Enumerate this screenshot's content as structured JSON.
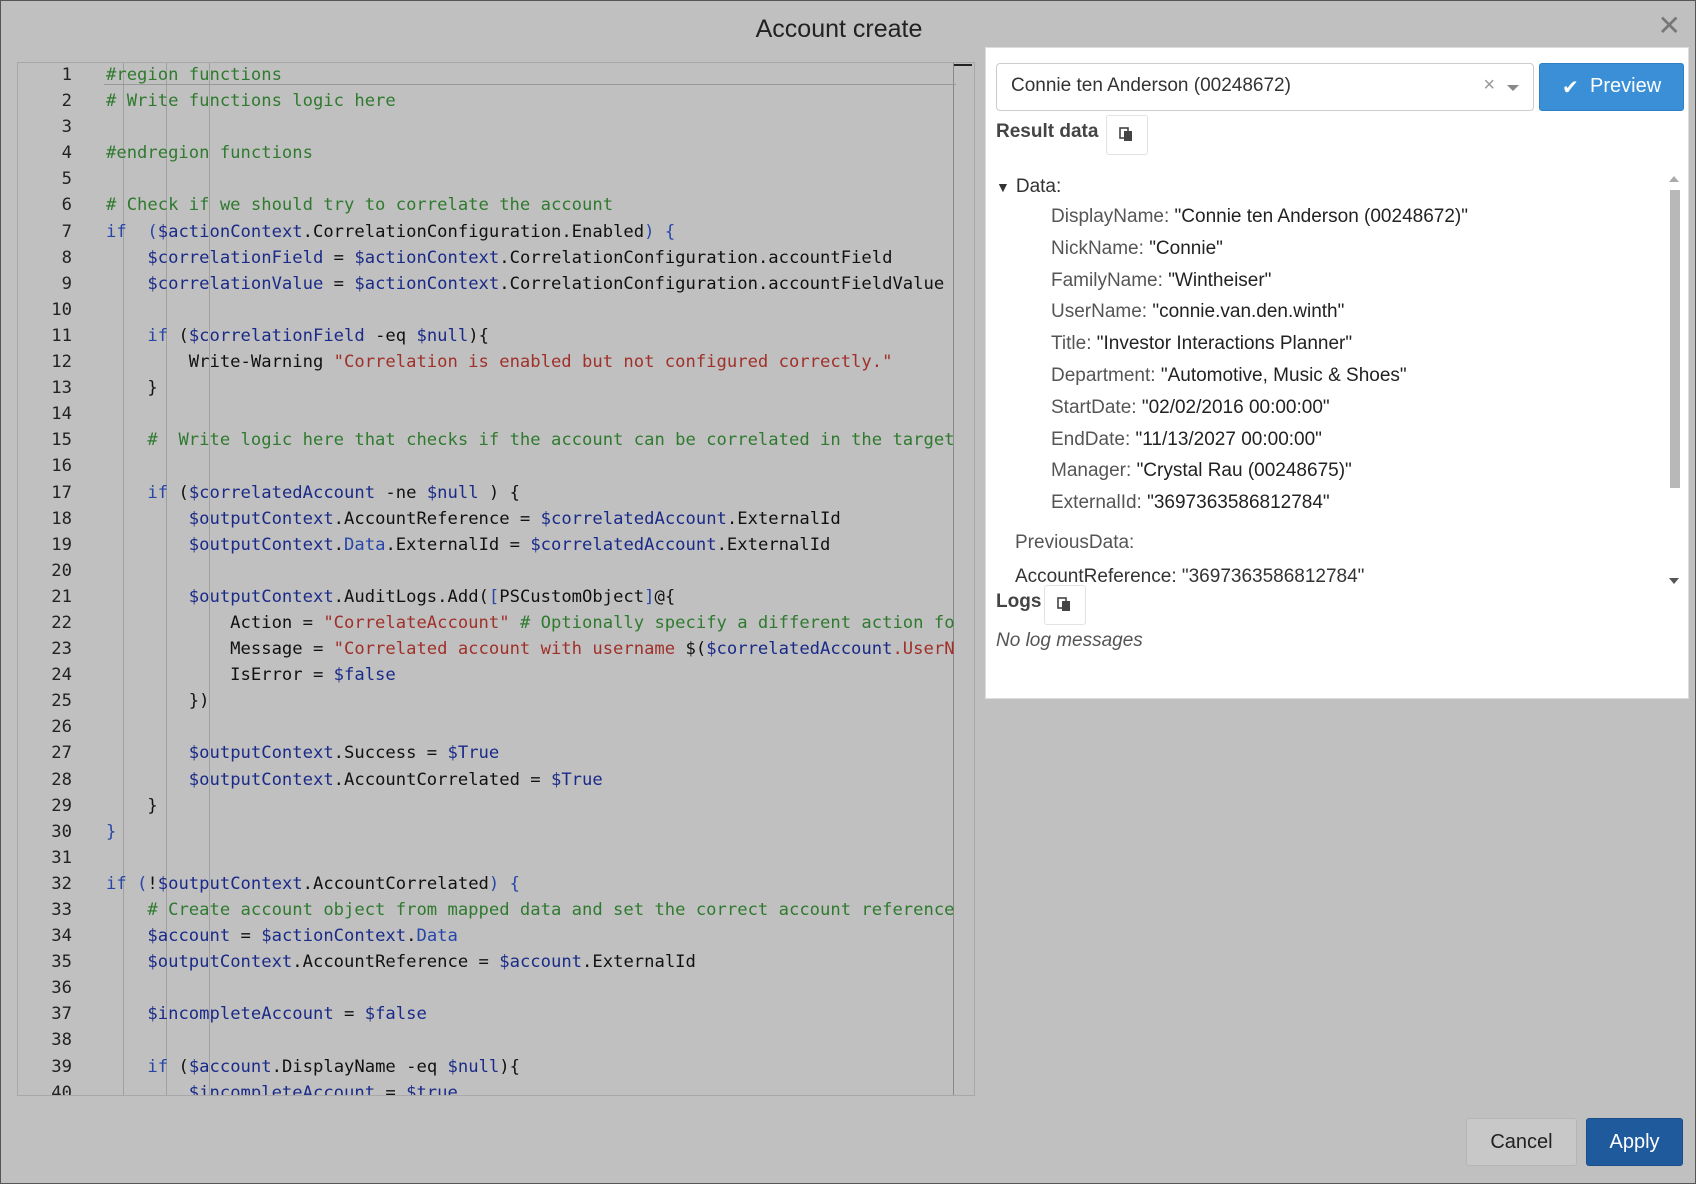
{
  "dialog": {
    "title": "Account create",
    "close": "✕"
  },
  "editor": {
    "lines": [
      {
        "n": "1",
        "t": [
          [
            "c",
            "#region functions"
          ]
        ]
      },
      {
        "n": "2",
        "t": [
          [
            "c",
            "# Write functions logic here"
          ]
        ]
      },
      {
        "n": "3",
        "t": []
      },
      {
        "n": "4",
        "t": [
          [
            "c",
            "#endregion functions"
          ]
        ]
      },
      {
        "n": "5",
        "t": []
      },
      {
        "n": "6",
        "t": [
          [
            "c",
            "# Check if we should try to correlate the account"
          ]
        ]
      },
      {
        "n": "7",
        "t": [
          [
            "k",
            "if"
          ],
          [
            "",
            "  "
          ],
          [
            "b",
            "("
          ],
          [
            "v",
            "$actionContext"
          ],
          [
            "",
            ".CorrelationConfiguration.Enabled"
          ],
          [
            "b",
            ")"
          ],
          [
            "",
            " "
          ],
          [
            "b",
            "{"
          ]
        ]
      },
      {
        "n": "8",
        "t": [
          [
            "",
            "    "
          ],
          [
            "v",
            "$correlationField"
          ],
          [
            "",
            " = "
          ],
          [
            "v",
            "$actionContext"
          ],
          [
            "",
            ".CorrelationConfiguration.accountField"
          ]
        ]
      },
      {
        "n": "9",
        "t": [
          [
            "",
            "    "
          ],
          [
            "v",
            "$correlationValue"
          ],
          [
            "",
            " = "
          ],
          [
            "v",
            "$actionContext"
          ],
          [
            "",
            ".CorrelationConfiguration.accountFieldValue"
          ]
        ]
      },
      {
        "n": "10",
        "t": []
      },
      {
        "n": "11",
        "t": [
          [
            "",
            "    "
          ],
          [
            "k",
            "if"
          ],
          [
            "",
            " ("
          ],
          [
            "v",
            "$correlationField"
          ],
          [
            "",
            " -eq "
          ],
          [
            "v",
            "$null"
          ],
          [
            "",
            "){"
          ]
        ]
      },
      {
        "n": "12",
        "t": [
          [
            "",
            "        Write-Warning "
          ],
          [
            "s",
            "\"Correlation is enabled but not configured correctly.\""
          ]
        ]
      },
      {
        "n": "13",
        "t": [
          [
            "",
            "    }"
          ]
        ]
      },
      {
        "n": "14",
        "t": []
      },
      {
        "n": "15",
        "t": [
          [
            "",
            "    "
          ],
          [
            "c",
            "#  Write logic here that checks if the account can be correlated in the target"
          ]
        ]
      },
      {
        "n": "16",
        "t": []
      },
      {
        "n": "17",
        "t": [
          [
            "",
            "    "
          ],
          [
            "k",
            "if"
          ],
          [
            "",
            " ("
          ],
          [
            "v",
            "$correlatedAccount"
          ],
          [
            "",
            " -ne "
          ],
          [
            "v",
            "$null"
          ],
          [
            "",
            " ) {"
          ]
        ]
      },
      {
        "n": "18",
        "t": [
          [
            "",
            "        "
          ],
          [
            "v",
            "$outputContext"
          ],
          [
            "",
            ".AccountReference = "
          ],
          [
            "v",
            "$correlatedAccount"
          ],
          [
            "",
            ".ExternalId"
          ]
        ]
      },
      {
        "n": "19",
        "t": [
          [
            "",
            "        "
          ],
          [
            "v",
            "$outputContext"
          ],
          [
            "",
            "."
          ],
          [
            "k",
            "Data"
          ],
          [
            "",
            ".ExternalId = "
          ],
          [
            "v",
            "$correlatedAccount"
          ],
          [
            "",
            ".ExternalId"
          ]
        ]
      },
      {
        "n": "20",
        "t": []
      },
      {
        "n": "21",
        "t": [
          [
            "",
            "        "
          ],
          [
            "v",
            "$outputContext"
          ],
          [
            "",
            ".AuditLogs.Add("
          ],
          [
            "b",
            "["
          ],
          [
            "",
            "PSCustomObject"
          ],
          [
            "b",
            "]"
          ],
          [
            "",
            "@{"
          ]
        ]
      },
      {
        "n": "22",
        "t": [
          [
            "",
            "            Action = "
          ],
          [
            "s",
            "\"CorrelateAccount\""
          ],
          [
            "",
            " "
          ],
          [
            "c",
            "# Optionally specify a different action fo"
          ]
        ]
      },
      {
        "n": "23",
        "t": [
          [
            "",
            "            Message = "
          ],
          [
            "s",
            "\"Correlated account with username "
          ],
          [
            "",
            "$("
          ],
          [
            "v",
            "$correlatedAccount"
          ],
          [
            "s",
            ".UserN"
          ]
        ]
      },
      {
        "n": "24",
        "t": [
          [
            "",
            "            IsError = "
          ],
          [
            "v",
            "$false"
          ]
        ]
      },
      {
        "n": "25",
        "t": [
          [
            "",
            "        })"
          ]
        ]
      },
      {
        "n": "26",
        "t": []
      },
      {
        "n": "27",
        "t": [
          [
            "",
            "        "
          ],
          [
            "v",
            "$outputContext"
          ],
          [
            "",
            ".Success = "
          ],
          [
            "v",
            "$True"
          ]
        ]
      },
      {
        "n": "28",
        "t": [
          [
            "",
            "        "
          ],
          [
            "v",
            "$outputContext"
          ],
          [
            "",
            ".AccountCorrelated = "
          ],
          [
            "v",
            "$True"
          ]
        ]
      },
      {
        "n": "29",
        "t": [
          [
            "",
            "    }"
          ]
        ]
      },
      {
        "n": "30",
        "t": [
          [
            "b",
            "}"
          ]
        ]
      },
      {
        "n": "31",
        "t": []
      },
      {
        "n": "32",
        "t": [
          [
            "k",
            "if"
          ],
          [
            "b",
            " ("
          ],
          [
            "",
            "!"
          ],
          [
            "v",
            "$outputContext"
          ],
          [
            "",
            ".AccountCorrelated"
          ],
          [
            "b",
            ")"
          ],
          [
            "",
            " "
          ],
          [
            "b",
            "{"
          ]
        ]
      },
      {
        "n": "33",
        "t": [
          [
            "",
            "    "
          ],
          [
            "c",
            "# Create account object from mapped data and set the correct account reference"
          ]
        ]
      },
      {
        "n": "34",
        "t": [
          [
            "",
            "    "
          ],
          [
            "v",
            "$account"
          ],
          [
            "",
            " = "
          ],
          [
            "v",
            "$actionContext"
          ],
          [
            "",
            "."
          ],
          [
            "k",
            "Data"
          ]
        ]
      },
      {
        "n": "35",
        "t": [
          [
            "",
            "    "
          ],
          [
            "v",
            "$outputContext"
          ],
          [
            "",
            ".AccountReference = "
          ],
          [
            "v",
            "$account"
          ],
          [
            "",
            ".ExternalId"
          ]
        ]
      },
      {
        "n": "36",
        "t": []
      },
      {
        "n": "37",
        "t": [
          [
            "",
            "    "
          ],
          [
            "v",
            "$incompleteAccount"
          ],
          [
            "",
            " = "
          ],
          [
            "v",
            "$false"
          ]
        ]
      },
      {
        "n": "38",
        "t": []
      },
      {
        "n": "39",
        "t": [
          [
            "",
            "    "
          ],
          [
            "k",
            "if"
          ],
          [
            "",
            " ("
          ],
          [
            "v",
            "$account"
          ],
          [
            "",
            ".DisplayName -eq "
          ],
          [
            "v",
            "$null"
          ],
          [
            "",
            "){"
          ]
        ]
      },
      {
        "n": "40",
        "t": [
          [
            "",
            "        "
          ],
          [
            "v",
            "$incompleteAccount"
          ],
          [
            "",
            " = "
          ],
          [
            "v",
            "$true"
          ]
        ]
      }
    ]
  },
  "person_select": {
    "value": "Connie ten Anderson (00248672)",
    "clear": "×"
  },
  "preview_button": {
    "icon": "✔",
    "label": "Preview"
  },
  "result": {
    "label": "Result data",
    "root": "Data:",
    "fields": [
      {
        "key": "DisplayName:",
        "value": "\"Connie ten Anderson (00248672)\""
      },
      {
        "key": "NickName:",
        "value": "\"Connie\""
      },
      {
        "key": "FamilyName:",
        "value": "\"Wintheiser\""
      },
      {
        "key": "UserName:",
        "value": "\"connie.van.den.winth\""
      },
      {
        "key": "Title:",
        "value": "\"Investor Interactions Planner\""
      },
      {
        "key": "Department:",
        "value": "\"Automotive, Music & Shoes\""
      },
      {
        "key": "StartDate:",
        "value": "\"02/02/2016 00:00:00\""
      },
      {
        "key": "EndDate:",
        "value": "\"11/13/2027 00:00:00\""
      },
      {
        "key": "Manager:",
        "value": "\"Crystal Rau (00248675)\""
      },
      {
        "key": "ExternalId:",
        "value": "\"3697363586812784\""
      }
    ],
    "previous": "PreviousData:",
    "partial_row": "AccountReference: \"3697363586812784\""
  },
  "logs": {
    "label": "Logs",
    "empty": "No log messages"
  },
  "footer": {
    "cancel": "Cancel",
    "apply": "Apply"
  },
  "colors": {
    "background": "#c0c0c0",
    "preview": "#3a8fd6",
    "apply": "#1f5a9c",
    "comment": "#2f7a2f",
    "keyword": "#2646a8",
    "string": "#a0302a"
  }
}
